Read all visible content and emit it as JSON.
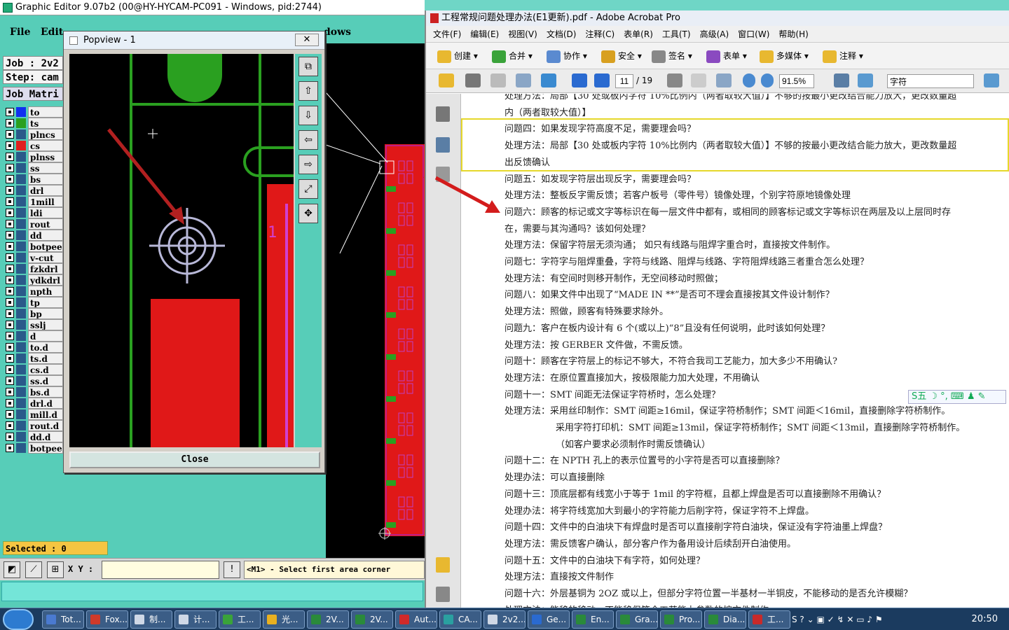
{
  "graphic_editor": {
    "title": "Graphic Editor 9.07b2 (00@HY-HYCAM-PC091 - Windows, pid:2744)",
    "menu": [
      "File",
      "Edit",
      "dows"
    ],
    "job": "Job  : 2v2",
    "step": "Step: cam",
    "job_matrix": "Job Matri",
    "layers": [
      {
        "name": "to",
        "color": "#1030f0"
      },
      {
        "name": "ts",
        "color": "#2aa020"
      },
      {
        "name": "plncs",
        "color": "#2a5a8a"
      },
      {
        "name": "cs",
        "color": "#e02020"
      },
      {
        "name": "plnss",
        "color": "#2a5a8a"
      },
      {
        "name": "ss",
        "color": "#2a5a8a"
      },
      {
        "name": "bs",
        "color": "#2a5a8a"
      },
      {
        "name": "drl",
        "color": "#2a5a8a"
      },
      {
        "name": "1mill",
        "color": "#2a5a8a"
      },
      {
        "name": "ldi",
        "color": "#2a5a8a"
      },
      {
        "name": "rout",
        "color": "#2a5a8a"
      },
      {
        "name": "dd",
        "color": "#2a5a8a"
      },
      {
        "name": "botpeel",
        "color": "#2a5a8a"
      },
      {
        "name": "v-cut",
        "color": "#2a5a8a"
      },
      {
        "name": "fzkdrl",
        "color": "#2a5a8a"
      },
      {
        "name": "ydkdrl",
        "color": "#2a5a8a"
      },
      {
        "name": "npth",
        "color": "#2a5a8a"
      },
      {
        "name": "tp",
        "color": "#2a5a8a"
      },
      {
        "name": "bp",
        "color": "#2a5a8a"
      },
      {
        "name": "sslj",
        "color": "#2a5a8a"
      },
      {
        "name": "d",
        "color": "#2a5a8a"
      },
      {
        "name": "to.d",
        "color": "#2a5a8a"
      },
      {
        "name": "ts.d",
        "color": "#2a5a8a"
      },
      {
        "name": "cs.d",
        "color": "#2a5a8a"
      },
      {
        "name": "ss.d",
        "color": "#2a5a8a"
      },
      {
        "name": "bs.d",
        "color": "#2a5a8a"
      },
      {
        "name": "drl.d",
        "color": "#2a5a8a"
      },
      {
        "name": "mill.d",
        "color": "#2a5a8a"
      },
      {
        "name": "rout.d",
        "color": "#2a5a8a"
      },
      {
        "name": "dd.d",
        "color": "#2a5a8a"
      },
      {
        "name": "botpeel.d",
        "color": "#2a5a8a"
      }
    ],
    "selected": "Selected : 0",
    "xy_label": "X Y :",
    "xy_value": "",
    "prompt": "<M1> - Select first area corner"
  },
  "popview": {
    "title": "Popview - 1",
    "close_x": "✕",
    "close_label": "Close",
    "canvas_text": "1",
    "side_icons": [
      "zoom-fit-icon",
      "pan-up-icon",
      "pan-down-icon",
      "pan-left-icon",
      "pan-right-icon",
      "zoom-in-icon",
      "zoom-out-icon"
    ]
  },
  "acrobat": {
    "title": "工程常规问题处理办法(E1更新).pdf - Adobe Acrobat Pro",
    "menu": [
      "文件(F)",
      "编辑(E)",
      "视图(V)",
      "文档(D)",
      "注释(C)",
      "表单(R)",
      "工具(T)",
      "高级(A)",
      "窗口(W)",
      "帮助(H)"
    ],
    "toolbar": [
      "创建",
      "合并",
      "协作",
      "安全",
      "签名",
      "表单",
      "多媒体",
      "注释"
    ],
    "page_current": "11",
    "page_total": "/ 19",
    "zoom": "91.5%",
    "find_placeholder": "字符",
    "lines": [
      {
        "text": "处理方法：局部【30 处或板内字符 10%比例内（两者取较大值）】不够的按最小更改结合能力放大，更改数量超",
        "indent": false
      },
      {
        "text": "内（两者取较大值）】",
        "indent": false
      },
      {
        "text": "问题四：如果发现字符高度不足，需要理会吗？",
        "indent": false
      },
      {
        "text": "处理方法：局部【30 处或板内字符 10%比例内（两者取较大值）】不够的按最小更改结合能力放大，更改数量超",
        "indent": false
      },
      {
        "text": "出反馈确认",
        "indent": false
      },
      {
        "text": "问题五：如发现字符层出现反字，需要理会吗？",
        "indent": false
      },
      {
        "text": "处理方法：整板反字需反馈；若客户板号（零件号）镜像处理，个别字符原地镜像处理",
        "indent": false
      },
      {
        "text": "问题六：顾客的标记或文字等标识在每一层文件中都有，或相同的顾客标记或文字等标识在两层及以上层同时存",
        "indent": false
      },
      {
        "text": "在，需要与其沟通吗？该如何处理？",
        "indent": false
      },
      {
        "text": "处理方法：保留字符层无须沟通；  如只有线路与阻焊字重合时，直接按文件制作。",
        "indent": false
      },
      {
        "text": "问题七：字符字与阻焊重叠，字符与线路、阻焊与线路、字符阻焊线路三者重合怎么处理？",
        "indent": false
      },
      {
        "text": "处理方法：有空间时则移开制作，无空间移动时照做；",
        "indent": false
      },
      {
        "text": "问题八：如果文件中出现了“MADE IN **”是否可不理会直接按其文件设计制作？",
        "indent": false
      },
      {
        "text": "处理方法：照做，顾客有特殊要求除外。",
        "indent": false
      },
      {
        "text": "问题九：客户在板内设计有 6 个(或以上)“8”且没有任何说明，此时该如何处理？",
        "indent": false
      },
      {
        "text": "处理方法：按 GERBER 文件做，不需反馈。",
        "indent": false
      },
      {
        "text": "问题十：顾客在字符层上的标记不够大，不符合我司工艺能力，加大多少不用确认?",
        "indent": false
      },
      {
        "text": "处理方法：在原位置直接加大，按极限能力加大处理，不用确认",
        "indent": false
      },
      {
        "text": "问题十一：SMT 间距无法保证字符桥时，怎么处理？",
        "indent": false
      },
      {
        "text": "处理方法：采用丝印制作：SMT 间距≥16mil，保证字符桥制作；SMT 间距＜16mil，直接删除字符桥制作。",
        "indent": false
      },
      {
        "text": "采用字符打印机：SMT 间距≥13mil，保证字符桥制作；SMT 间距＜13mil，直接删除字符桥制作。",
        "indent": true
      },
      {
        "text": "（如客户要求必须制作时需反馈确认）",
        "indent": true
      },
      {
        "text": "问题十二：在 NPTH 孔上的表示位置号的小字符是否可以直接删除？",
        "indent": false
      },
      {
        "text": "处理办法：可以直接删除",
        "indent": false
      },
      {
        "text": "问题十三：顶底层都有线宽小于等于 1mil 的字符框，且都上焊盘是否可以直接删除不用确认？",
        "indent": false
      },
      {
        "text": "处理办法：将字符线宽加大到最小的字符能力后削字符，保证字符不上焊盘。",
        "indent": false
      },
      {
        "text": "问题十四：文件中的白油块下有焊盘时是否可以直接削字符白油块，保证没有字符油墨上焊盘？",
        "indent": false
      },
      {
        "text": "处理方法：需反馈客户确认，部分客户作为备用设计后续刮开白油使用。",
        "indent": false
      },
      {
        "text": "问题十五：文件中的白油块下有字符，如何处理？",
        "indent": false
      },
      {
        "text": "处理方法：直接按文件制作",
        "indent": false
      },
      {
        "text": "问题十六：外层基铜为 2OZ 或以上，但部分字符位置一半基材一半铜皮，不能移动的是否允许模糊？",
        "indent": false
      },
      {
        "text": "处理方法：能移的移动，不能移但符合工艺能力参数的按文件制作",
        "indent": false
      }
    ],
    "ime": "S五 ☽ °, ⌨ ♟ ✎"
  },
  "taskbar": {
    "items": [
      {
        "label": "Tot...",
        "color": "#4a7ad0"
      },
      {
        "label": "Fox...",
        "color": "#d03a2a"
      },
      {
        "label": "制...",
        "color": "#cfd8e6"
      },
      {
        "label": "计...",
        "color": "#cfd8e6"
      },
      {
        "label": "工...",
        "color": "#3aa33a"
      },
      {
        "label": "光...",
        "color": "#e8b020"
      },
      {
        "label": "2V...",
        "color": "#2a8a3a"
      },
      {
        "label": "2V...",
        "color": "#2a8a3a"
      },
      {
        "label": "Aut...",
        "color": "#d02a2a"
      },
      {
        "label": "CA...",
        "color": "#2aa0a0"
      },
      {
        "label": "2v2...",
        "color": "#cfd8e6"
      },
      {
        "label": "Ge...",
        "color": "#2a6ad0"
      },
      {
        "label": "En...",
        "color": "#2a8a3a"
      },
      {
        "label": "Gra...",
        "color": "#2a8a3a"
      },
      {
        "label": "Pro...",
        "color": "#2a8a3a"
      },
      {
        "label": "Dia...",
        "color": "#2a8a3a"
      },
      {
        "label": "工...",
        "color": "#c82a2a"
      }
    ],
    "clock": "20:50"
  }
}
